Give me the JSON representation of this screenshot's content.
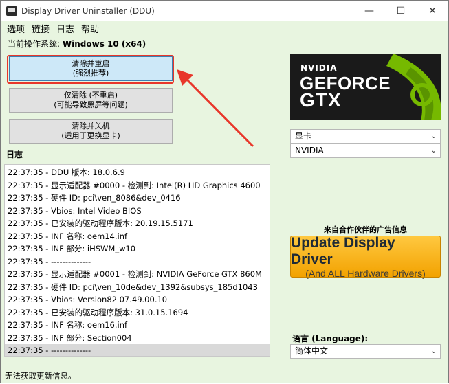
{
  "window": {
    "title": "Display Driver Uninstaller (DDU)",
    "controls": {
      "minimize": "—",
      "maximize": "☐",
      "close": "✕"
    }
  },
  "menu": [
    "选项",
    "链接",
    "日志",
    "帮助"
  ],
  "os": {
    "label": "当前操作系统:",
    "value": "Windows 10 (x64)"
  },
  "actions": [
    {
      "line1": "清除并重启",
      "line2": "(强烈推荐)"
    },
    {
      "line1": "仅清除 (不重启)",
      "line2": "(可能导致黑屏等问题)"
    },
    {
      "line1": "清除并关机",
      "line2": "(适用于更换显卡)"
    }
  ],
  "log": {
    "label": "日志",
    "rows": [
      "22:37:35 - DDU 版本: 18.0.6.9",
      "22:37:35 - 显示适配器 #0000 - 检测到: Intel(R) HD Graphics 4600",
      "22:37:35 - 硬件 ID: pci\\ven_8086&dev_0416",
      "22:37:35 - Vbios: Intel Video BIOS",
      "22:37:35 - 已安装的驱动程序版本: 20.19.15.5171",
      "22:37:35 - INF 名称: oem14.inf",
      "22:37:35 - INF 部分: iHSWM_w10",
      "22:37:35 - --------------",
      "22:37:35 - 显示适配器 #0001 - 检测到: NVIDIA GeForce GTX 860M",
      "22:37:35 - 硬件 ID: pci\\ven_10de&dev_1392&subsys_185d1043",
      "22:37:35 - Vbios: Version82 07.49.00.10",
      "22:37:35 - 已安装的驱动程序版本: 31.0.15.1694",
      "22:37:35 - INF 名称: oem16.inf",
      "22:37:35 - INF 部分: Section004",
      "22:37:35 - --------------"
    ],
    "selected_index": 14
  },
  "status": "无法获取更新信息。",
  "banner": {
    "brand": "NVIDIA",
    "line1": "GEFORCE",
    "line2": "GTX"
  },
  "device_type": {
    "value": "显卡"
  },
  "vendor": {
    "value": "NVIDIA"
  },
  "ad": {
    "caption": "来自合作伙伴的广告信息",
    "title": "Update Display Driver",
    "subtitle": "(And ALL Hardware Drivers)"
  },
  "language": {
    "label": "语言 (Language):",
    "value": "简体中文"
  },
  "colors": {
    "window_bg": "#e8f5e0",
    "primary_button": "#cde8f8",
    "highlight": "#e8372b",
    "ad_orange": "#f2a200",
    "nvidia_green": "#76b900"
  }
}
